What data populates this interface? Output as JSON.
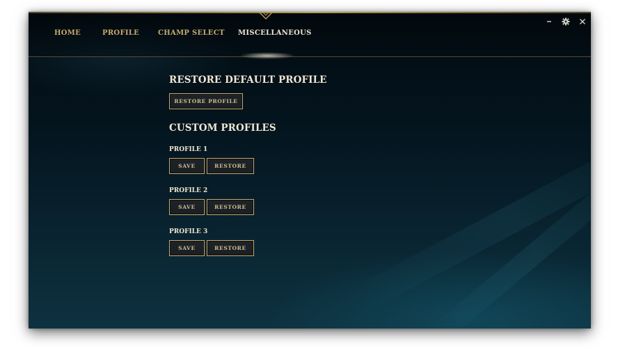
{
  "nav": {
    "items": [
      {
        "label": "HOME",
        "active": false
      },
      {
        "label": "PROFILE",
        "active": false
      },
      {
        "label": "CHAMP SELECT",
        "active": false
      },
      {
        "label": "MISCELLANEOUS",
        "active": true
      }
    ]
  },
  "window_controls": {
    "minimize": "minimize-icon",
    "settings": "gear-icon",
    "close": "close-icon"
  },
  "restore_default": {
    "heading": "RESTORE DEFAULT PROFILE",
    "button_label": "RESTORE PROFILE"
  },
  "custom_profiles": {
    "heading": "CUSTOM PROFILES",
    "profiles": [
      {
        "label": "PROFILE 1",
        "save_label": "SAVE",
        "restore_label": "RESTORE"
      },
      {
        "label": "PROFILE 2",
        "save_label": "SAVE",
        "restore_label": "RESTORE"
      },
      {
        "label": "PROFILE 3",
        "save_label": "SAVE",
        "restore_label": "RESTORE"
      }
    ]
  },
  "colors": {
    "accent_gold": "#c8aa6e",
    "text_light": "#f0e6d2",
    "background": "#041620"
  }
}
